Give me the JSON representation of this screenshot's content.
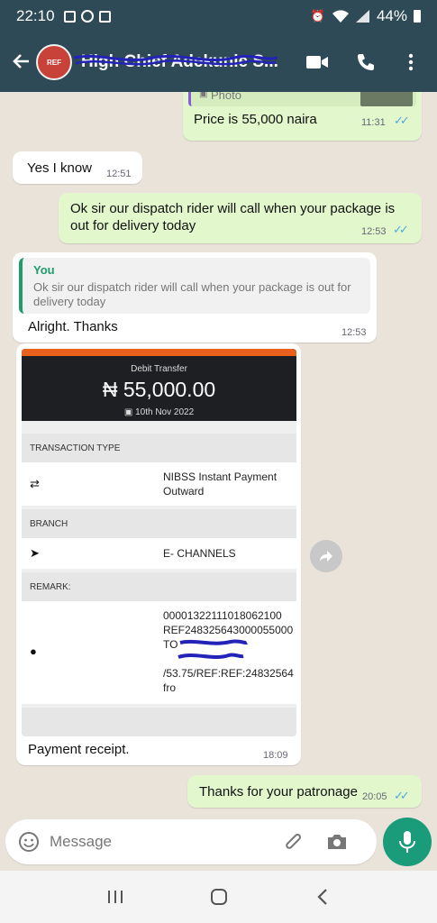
{
  "status_bar": {
    "time": "22:10",
    "battery": "44%"
  },
  "header": {
    "avatar_text": "REF",
    "contact_name": "High Chief Adekunle S...",
    "icons": [
      "back-arrow-icon",
      "video-call-icon",
      "phone-icon",
      "more-options-icon"
    ]
  },
  "messages": {
    "photo_reply": {
      "quote": "Photo",
      "text": "Price is 55,000 naira",
      "time": "11:31"
    },
    "m2": {
      "text": "Yes I know",
      "time": "12:51"
    },
    "m3": {
      "text": "Ok sir our dispatch rider will call when your package is out for delivery today",
      "time": "12:53"
    },
    "m4": {
      "quote_author": "You",
      "quote_text": "Ok sir our dispatch rider will call when your package is out for delivery today",
      "text": "Alright. Thanks",
      "time": "12:53"
    },
    "receipt": {
      "caption": "Payment receipt.",
      "time": "18:09"
    },
    "m6": {
      "text": "Thanks for your patronage",
      "time": "20:05"
    }
  },
  "receipt_card": {
    "title": "Debit Transfer",
    "amount": "₦ 55,000.00",
    "date": "10th Nov 2022",
    "transaction_type_label": "TRANSACTION TYPE",
    "transaction_type_line1": "NIBSS Instant Payment",
    "transaction_type_line2": "Outward",
    "branch_label": "BRANCH",
    "branch_value": "E- CHANNELS",
    "remark_label": "REMARK:",
    "remark_line1": "00001322111018062100",
    "remark_line2": "REF248325643000055000",
    "remark_line3": "TO",
    "remark_line5": "/53.75/REF:REF:24832564",
    "remark_line6": "fro"
  },
  "input_bar": {
    "placeholder": "Message"
  },
  "colors": {
    "header": "#2e4a57",
    "outgoing": "#e2f7cb",
    "incoming": "#ffffff",
    "accent": "#1a9c7a",
    "read_ticks": "#4fa8e0",
    "receipt_stripe": "#e8611c"
  }
}
